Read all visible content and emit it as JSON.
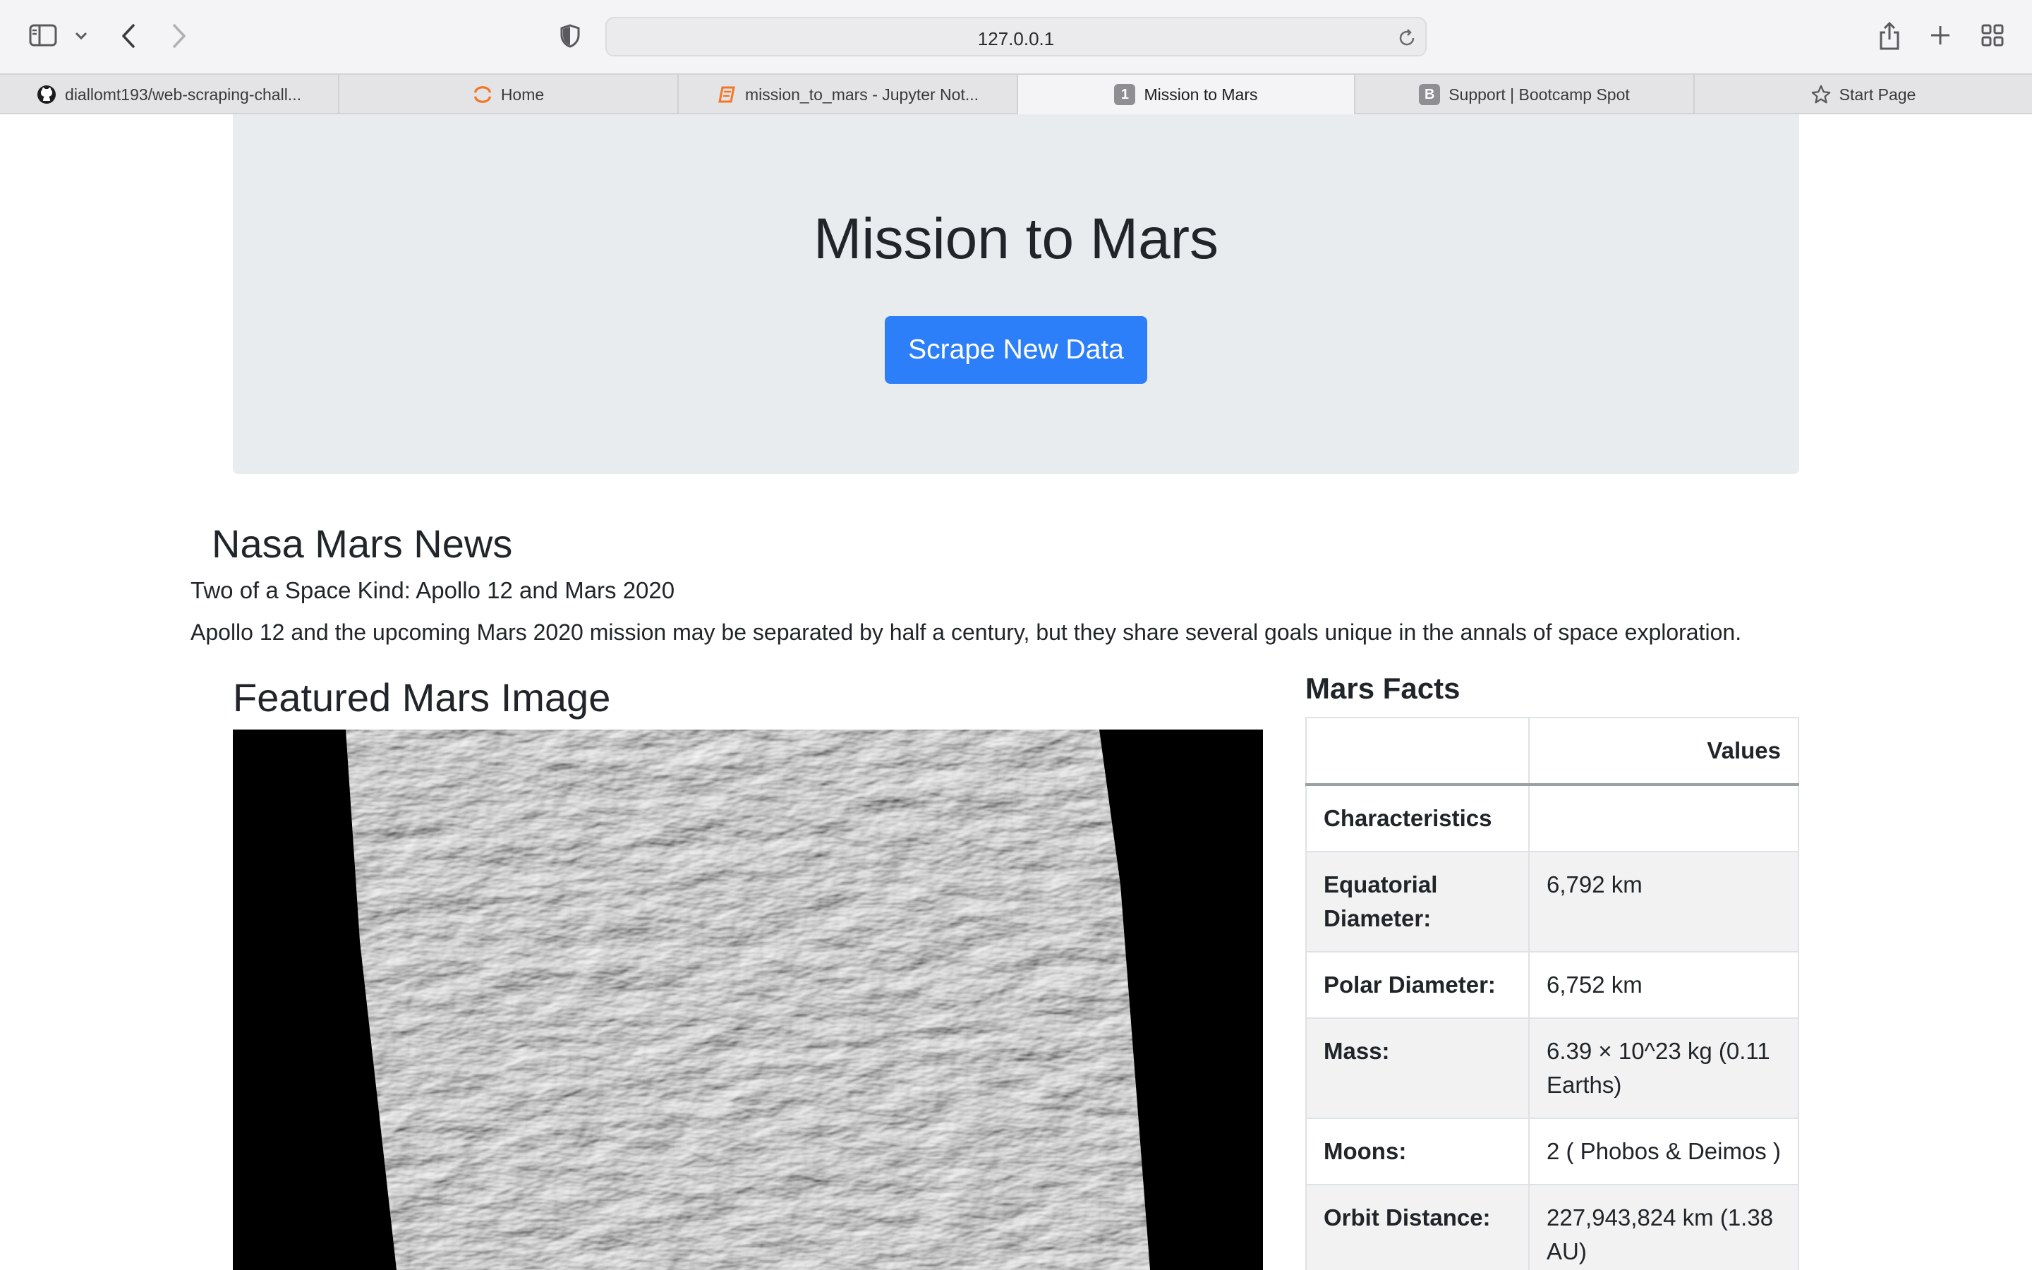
{
  "browser": {
    "url": "127.0.0.1",
    "tabs": [
      {
        "label": "diallomt193/web-scraping-chall...",
        "icon": "github-icon"
      },
      {
        "label": "Home",
        "icon": "jupyter-icon"
      },
      {
        "label": "mission_to_mars - Jupyter Not...",
        "icon": "notebook-icon"
      },
      {
        "label": "Mission to Mars",
        "icon": "number-badge-icon",
        "badge": "1",
        "active": true
      },
      {
        "label": "Support | Bootcamp Spot",
        "icon": "letter-badge-icon",
        "badge": "B"
      },
      {
        "label": "Start Page",
        "icon": "star-icon"
      }
    ]
  },
  "jumbotron": {
    "title": "Mission to Mars",
    "button_label": "Scrape New Data",
    "button_color": "#2d7ff9"
  },
  "news": {
    "section_title": "Nasa Mars News",
    "headline": "Two of a Space Kind: Apollo 12 and Mars 2020",
    "paragraph": "Apollo 12 and the upcoming Mars 2020 mission may be separated by half a century, but they share several goals unique in the annals of space exploration."
  },
  "featured_image": {
    "section_title": "Featured Mars Image"
  },
  "facts": {
    "section_title": "Mars Facts",
    "header": [
      "",
      "Values"
    ],
    "rows": [
      {
        "label": "Characteristics",
        "value": ""
      },
      {
        "label": "Equatorial Diameter:",
        "value": "6,792 km"
      },
      {
        "label": "Polar Diameter:",
        "value": "6,752 km"
      },
      {
        "label": "Mass:",
        "value": "6.39 × 10^23 kg (0.11 Earths)"
      },
      {
        "label": "Moons:",
        "value": "2 ( Phobos & Deimos )"
      },
      {
        "label": "Orbit Distance:",
        "value": "227,943,824 km (1.38 AU)"
      }
    ]
  }
}
